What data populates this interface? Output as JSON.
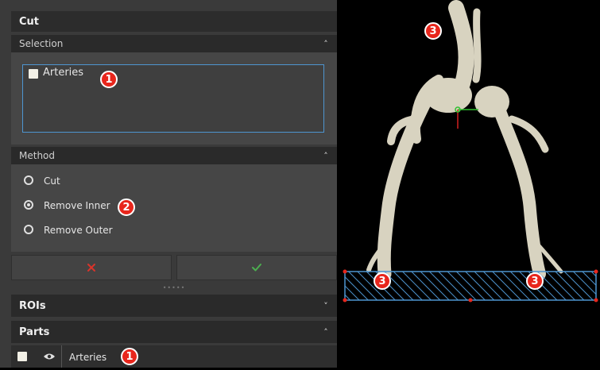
{
  "panel": {
    "title": "Cut",
    "selection": {
      "header": "Selection",
      "item_label": "Arteries",
      "badge": "1"
    },
    "method": {
      "header": "Method",
      "options": [
        {
          "label": "Cut",
          "selected": false
        },
        {
          "label": "Remove Inner",
          "selected": true
        },
        {
          "label": "Remove Outer",
          "selected": false
        }
      ],
      "badge": "2"
    },
    "buttons": {
      "cancel_icon": "x-icon",
      "confirm_icon": "check-icon",
      "cancel_color": "#d9342b",
      "confirm_color": "#4caf50"
    },
    "rois": {
      "header": "ROIs"
    },
    "parts": {
      "header": "Parts",
      "item_label": "Arteries",
      "badge": "1"
    }
  },
  "viewport": {
    "badges": [
      "3",
      "3",
      "3"
    ],
    "cut_region_color": "#4e95d0",
    "handle_color": "#e8261c"
  }
}
